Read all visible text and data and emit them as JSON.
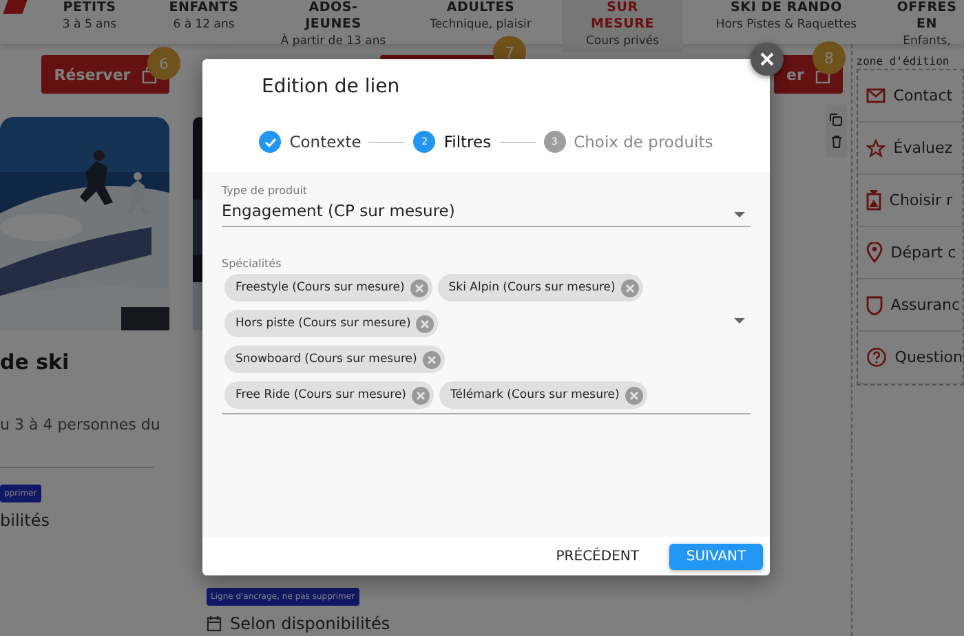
{
  "nav": {
    "tabs": [
      {
        "title": "PETITS",
        "subtitle": "3 à 5 ans",
        "selected": false
      },
      {
        "title": "ENFANTS",
        "subtitle": "6 à 12 ans",
        "selected": false
      },
      {
        "title": "ADOS-JEUNES",
        "subtitle": "À partir de 13 ans",
        "selected": false
      },
      {
        "title": "ADULTES",
        "subtitle": "Technique, plaisir",
        "selected": false
      },
      {
        "title": "SUR MESURE",
        "subtitle": "Cours privés",
        "selected": true
      },
      {
        "title": "SKI DE RANDO",
        "subtitle": "Hors Pistes & Raquettes",
        "selected": false
      },
      {
        "title": "OFFRES EN",
        "subtitle": "Enfants,",
        "selected": false
      }
    ]
  },
  "cards": [
    {
      "button": "Réserver",
      "badge": "6",
      "title": "de ski",
      "description": "u 3 à 4 personnes du",
      "tag": "pprimer",
      "availability": "bilités"
    },
    {
      "badge": "7",
      "tag": "Ligne d'ancrage, ne pas supprimer",
      "availability": "Selon disponibilités"
    },
    {
      "button": "er",
      "badge": "8"
    }
  ],
  "edit_zone": {
    "label": "zone d'édition"
  },
  "sidebar": {
    "items": [
      {
        "label": "Contact"
      },
      {
        "label": "Évaluez"
      },
      {
        "label": "Choisir r"
      },
      {
        "label": "Départ c"
      },
      {
        "label": "Assuranc"
      },
      {
        "label": "Question"
      }
    ]
  },
  "modal": {
    "title": "Edition de lien",
    "steps": [
      {
        "label": "Contexte",
        "completed": true,
        "selected": false
      },
      {
        "number": "2",
        "label": "Filtres",
        "completed": false,
        "selected": true
      },
      {
        "number": "3",
        "label": "Choix de produits",
        "completed": false,
        "selected": false
      }
    ],
    "product_type": {
      "label": "Type de produit",
      "value": "Engagement (CP sur mesure)"
    },
    "specialties": {
      "label": "Spécialités",
      "chips": [
        "Freestyle (Cours sur mesure)",
        "Ski Alpin (Cours sur mesure)",
        "Hors piste (Cours sur mesure)",
        "Snowboard (Cours sur mesure)",
        "Free Ride (Cours sur mesure)",
        "Télémark (Cours sur mesure)"
      ]
    },
    "buttons": {
      "back": "PRÉCÉDENT",
      "next": "SUIVANT"
    }
  }
}
